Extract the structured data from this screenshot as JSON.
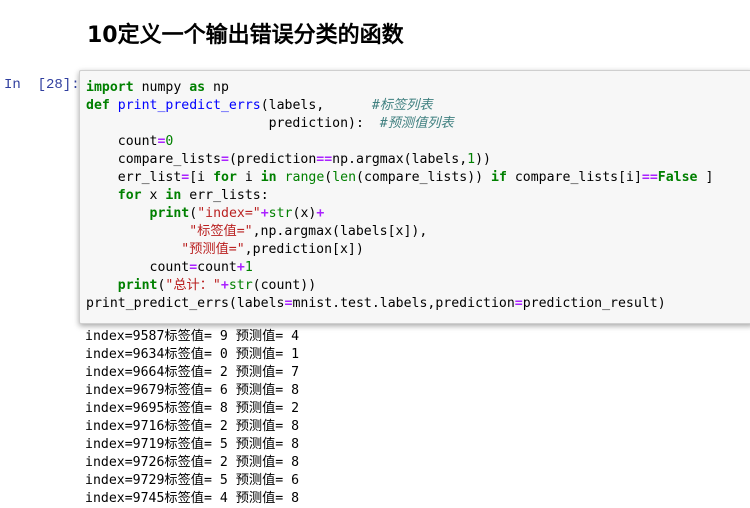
{
  "heading": "10定义一个输出错误分类的函数",
  "prompt": "In  [28]:",
  "code_lines": [
    [
      {
        "c": "kw",
        "t": "import"
      },
      {
        "c": "pl",
        "t": " numpy "
      },
      {
        "c": "kw",
        "t": "as"
      },
      {
        "c": "pl",
        "t": " np"
      }
    ],
    [
      {
        "c": "kw",
        "t": "def"
      },
      {
        "c": "pl",
        "t": " "
      },
      {
        "c": "fn",
        "t": "print_predict_errs"
      },
      {
        "c": "pl",
        "t": "(labels,      "
      },
      {
        "c": "cm",
        "t": "#标签列表"
      }
    ],
    [
      {
        "c": "pl",
        "t": "                       prediction):  "
      },
      {
        "c": "cm",
        "t": "#预测值列表"
      }
    ],
    [
      {
        "c": "pl",
        "t": "    count"
      },
      {
        "c": "op",
        "t": "="
      },
      {
        "c": "num",
        "t": "0"
      }
    ],
    [
      {
        "c": "pl",
        "t": "    compare_lists"
      },
      {
        "c": "op",
        "t": "="
      },
      {
        "c": "pl",
        "t": "(prediction"
      },
      {
        "c": "op",
        "t": "=="
      },
      {
        "c": "pl",
        "t": "np.argmax(labels,"
      },
      {
        "c": "num",
        "t": "1"
      },
      {
        "c": "pl",
        "t": "))"
      }
    ],
    [
      {
        "c": "pl",
        "t": "    err_list"
      },
      {
        "c": "op",
        "t": "="
      },
      {
        "c": "pl",
        "t": "[i "
      },
      {
        "c": "kw",
        "t": "for"
      },
      {
        "c": "pl",
        "t": " i "
      },
      {
        "c": "kw",
        "t": "in"
      },
      {
        "c": "pl",
        "t": " "
      },
      {
        "c": "bi",
        "t": "range"
      },
      {
        "c": "pl",
        "t": "("
      },
      {
        "c": "bi",
        "t": "len"
      },
      {
        "c": "pl",
        "t": "(compare_lists)) "
      },
      {
        "c": "kw",
        "t": "if"
      },
      {
        "c": "pl",
        "t": " compare_lists[i]"
      },
      {
        "c": "op",
        "t": "=="
      },
      {
        "c": "kw",
        "t": "False"
      },
      {
        "c": "pl",
        "t": " ]"
      }
    ],
    [
      {
        "c": "pl",
        "t": "    "
      },
      {
        "c": "kw",
        "t": "for"
      },
      {
        "c": "pl",
        "t": " x "
      },
      {
        "c": "kw",
        "t": "in"
      },
      {
        "c": "pl",
        "t": " err_lists:"
      }
    ],
    [
      {
        "c": "pl",
        "t": "        "
      },
      {
        "c": "kw",
        "t": "print"
      },
      {
        "c": "pl",
        "t": "("
      },
      {
        "c": "str",
        "t": "\"index=\""
      },
      {
        "c": "op",
        "t": "+"
      },
      {
        "c": "bi",
        "t": "str"
      },
      {
        "c": "pl",
        "t": "(x)"
      },
      {
        "c": "op",
        "t": "+"
      }
    ],
    [
      {
        "c": "pl",
        "t": "             "
      },
      {
        "c": "str",
        "t": "\"标签值=\""
      },
      {
        "c": "pl",
        "t": ",np.argmax(labels[x]),"
      }
    ],
    [
      {
        "c": "pl",
        "t": "            "
      },
      {
        "c": "str",
        "t": "\"预测值=\""
      },
      {
        "c": "pl",
        "t": ",prediction[x])"
      }
    ],
    [
      {
        "c": "pl",
        "t": "        count"
      },
      {
        "c": "op",
        "t": "="
      },
      {
        "c": "pl",
        "t": "count"
      },
      {
        "c": "op",
        "t": "+"
      },
      {
        "c": "num",
        "t": "1"
      }
    ],
    [
      {
        "c": "pl",
        "t": "    "
      },
      {
        "c": "kw",
        "t": "print"
      },
      {
        "c": "pl",
        "t": "("
      },
      {
        "c": "str",
        "t": "\"总计：\""
      },
      {
        "c": "op",
        "t": "+"
      },
      {
        "c": "bi",
        "t": "str"
      },
      {
        "c": "pl",
        "t": "(count))"
      }
    ],
    [
      {
        "c": "pl",
        "t": "print_predict_errs(labels"
      },
      {
        "c": "op",
        "t": "="
      },
      {
        "c": "pl",
        "t": "mnist.test.labels,prediction"
      },
      {
        "c": "op",
        "t": "="
      },
      {
        "c": "pl",
        "t": "prediction_result)"
      }
    ]
  ],
  "output_lines": [
    "index=9587标签值= 9 预测值= 4",
    "index=9634标签值= 0 预测值= 1",
    "index=9664标签值= 2 预测值= 7",
    "index=9679标签值= 6 预测值= 8",
    "index=9695标签值= 8 预测值= 2",
    "index=9716标签值= 2 预测值= 8",
    "index=9719标签值= 5 预测值= 8",
    "index=9726标签值= 2 预测值= 8",
    "index=9729标签值= 5 预测值= 6",
    "index=9745标签值= 4 预测值= 8"
  ],
  "colors": {
    "prompt": "#303f9f",
    "keyword": "#008000",
    "string": "#ba2121",
    "comment": "#408080",
    "operator": "#aa22ff",
    "cell_background": "#f7f7f7"
  }
}
